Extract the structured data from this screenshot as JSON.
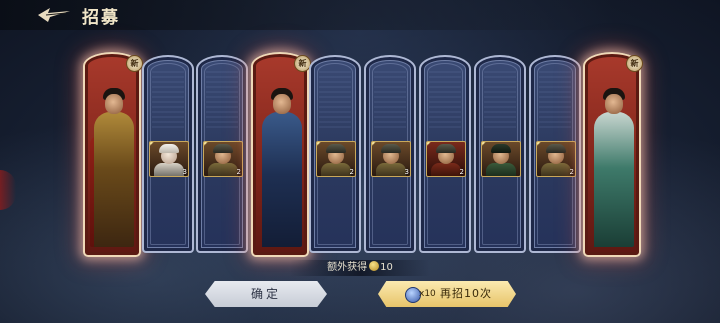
{
  "header": {
    "title": "招募",
    "back_icon": "back-arrow-icon"
  },
  "cards": [
    {
      "type": "hero",
      "badge": "新",
      "name": "gold-armored-lord",
      "tone": "gold"
    },
    {
      "type": "general",
      "stars": "3",
      "portrait": "white"
    },
    {
      "type": "general",
      "stars": "2",
      "portrait": "helmet"
    },
    {
      "type": "hero",
      "badge": "新",
      "name": "blue-armored-warrior",
      "tone": "blue"
    },
    {
      "type": "general",
      "stars": "2",
      "portrait": "helmet"
    },
    {
      "type": "general",
      "stars": "3",
      "portrait": "helmet"
    },
    {
      "type": "general",
      "stars": "2",
      "portrait": "red"
    },
    {
      "type": "general",
      "stars": "",
      "portrait": "green"
    },
    {
      "type": "general",
      "stars": "2",
      "portrait": "helmet"
    },
    {
      "type": "hero",
      "badge": "新",
      "name": "green-robed-strategist",
      "tone": "green"
    }
  ],
  "extra": {
    "text": "额外获得",
    "amount": "10"
  },
  "buttons": {
    "confirm_label": "确定",
    "recruit_cost": "x10",
    "recruit_label": "再招10次"
  },
  "colors": {
    "hero_frame": "#7d2319",
    "empty_frame": "#2c3a5f",
    "gold_button": "#e7c46a"
  }
}
